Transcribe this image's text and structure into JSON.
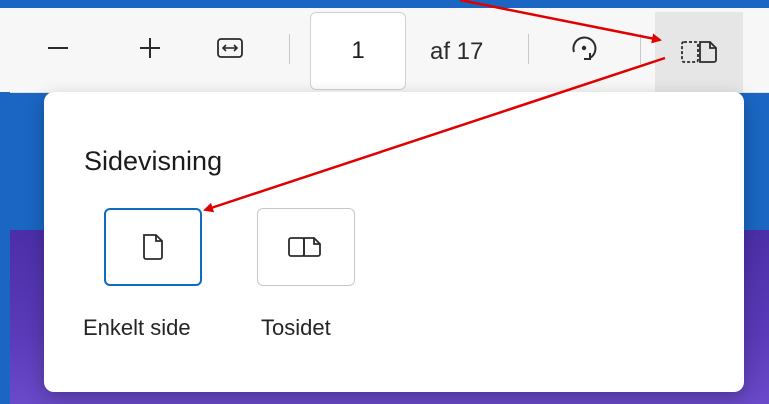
{
  "toolbar": {
    "page_number": "1",
    "page_total": "af 17",
    "zoom_out_icon": "minus-icon",
    "zoom_in_icon": "plus-icon",
    "fit_width_icon": "fit-width-icon",
    "rotate_icon": "rotate-icon",
    "page_layout_icon": "page-layout-icon"
  },
  "popup": {
    "title": "Sidevisning",
    "options": [
      {
        "label": "Enkelt side",
        "icon": "single-page-icon",
        "selected": true
      },
      {
        "label": "Tosidet",
        "icon": "two-page-icon",
        "selected": false
      }
    ]
  },
  "colors": {
    "accent": "#0f6cbd",
    "annotation_arrow": "#e00000",
    "background_blue": "#1a66c2"
  }
}
